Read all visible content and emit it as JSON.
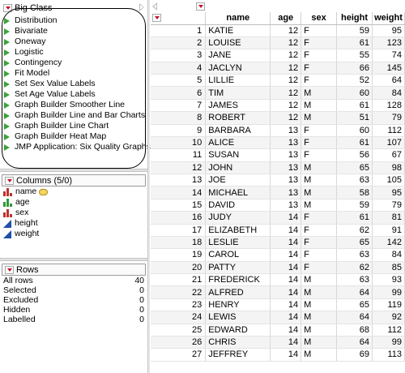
{
  "table_title": "Big Class",
  "scripts": [
    "Distribution",
    "Bivariate",
    "Oneway",
    "Logistic",
    "Contingency",
    "Fit Model",
    "Set Sex Value Labels",
    "Set Age Value Labels",
    "Graph Builder Smoother Line",
    "Graph Builder Line and Bar Charts",
    "Graph Builder Line Chart",
    "Graph Builder Heat Map",
    "JMP Application: Six Quality Graphs"
  ],
  "columns_panel": {
    "title": "Columns (5/0)",
    "items": [
      {
        "label": "name",
        "type": "nominal",
        "key": true
      },
      {
        "label": "age",
        "type": "ordinal",
        "key": false
      },
      {
        "label": "sex",
        "type": "nominal",
        "key": false
      },
      {
        "label": "height",
        "type": "continuous",
        "key": false
      },
      {
        "label": "weight",
        "type": "continuous",
        "key": false
      }
    ]
  },
  "rows_panel": {
    "title": "Rows",
    "stats": [
      {
        "label": "All rows",
        "value": "40"
      },
      {
        "label": "Selected",
        "value": "0"
      },
      {
        "label": "Excluded",
        "value": "0"
      },
      {
        "label": "Hidden",
        "value": "0"
      },
      {
        "label": "Labelled",
        "value": "0"
      }
    ]
  },
  "grid": {
    "headers": [
      "name",
      "age",
      "sex",
      "height",
      "weight"
    ],
    "rows": [
      [
        "1",
        "KATIE",
        "12",
        "F",
        "59",
        "95"
      ],
      [
        "2",
        "LOUISE",
        "12",
        "F",
        "61",
        "123"
      ],
      [
        "3",
        "JANE",
        "12",
        "F",
        "55",
        "74"
      ],
      [
        "4",
        "JACLYN",
        "12",
        "F",
        "66",
        "145"
      ],
      [
        "5",
        "LILLIE",
        "12",
        "F",
        "52",
        "64"
      ],
      [
        "6",
        "TIM",
        "12",
        "M",
        "60",
        "84"
      ],
      [
        "7",
        "JAMES",
        "12",
        "M",
        "61",
        "128"
      ],
      [
        "8",
        "ROBERT",
        "12",
        "M",
        "51",
        "79"
      ],
      [
        "9",
        "BARBARA",
        "13",
        "F",
        "60",
        "112"
      ],
      [
        "10",
        "ALICE",
        "13",
        "F",
        "61",
        "107"
      ],
      [
        "11",
        "SUSAN",
        "13",
        "F",
        "56",
        "67"
      ],
      [
        "12",
        "JOHN",
        "13",
        "M",
        "65",
        "98"
      ],
      [
        "13",
        "JOE",
        "13",
        "M",
        "63",
        "105"
      ],
      [
        "14",
        "MICHAEL",
        "13",
        "M",
        "58",
        "95"
      ],
      [
        "15",
        "DAVID",
        "13",
        "M",
        "59",
        "79"
      ],
      [
        "16",
        "JUDY",
        "14",
        "F",
        "61",
        "81"
      ],
      [
        "17",
        "ELIZABETH",
        "14",
        "F",
        "62",
        "91"
      ],
      [
        "18",
        "LESLIE",
        "14",
        "F",
        "65",
        "142"
      ],
      [
        "19",
        "CAROL",
        "14",
        "F",
        "63",
        "84"
      ],
      [
        "20",
        "PATTY",
        "14",
        "F",
        "62",
        "85"
      ],
      [
        "21",
        "FREDERICK",
        "14",
        "M",
        "63",
        "93"
      ],
      [
        "22",
        "ALFRED",
        "14",
        "M",
        "64",
        "99"
      ],
      [
        "23",
        "HENRY",
        "14",
        "M",
        "65",
        "119"
      ],
      [
        "24",
        "LEWIS",
        "14",
        "M",
        "64",
        "92"
      ],
      [
        "25",
        "EDWARD",
        "14",
        "M",
        "68",
        "112"
      ],
      [
        "26",
        "CHRIS",
        "14",
        "M",
        "64",
        "99"
      ],
      [
        "27",
        "JEFFREY",
        "14",
        "M",
        "69",
        "113"
      ]
    ]
  },
  "colors": {
    "red_triangle": "#c0142a",
    "script_play": "#3aa33a",
    "continuous_icon": "#1f4fa8",
    "nominal_icon": "#c2302b",
    "ordinal_icon": "#2e9a3a"
  }
}
